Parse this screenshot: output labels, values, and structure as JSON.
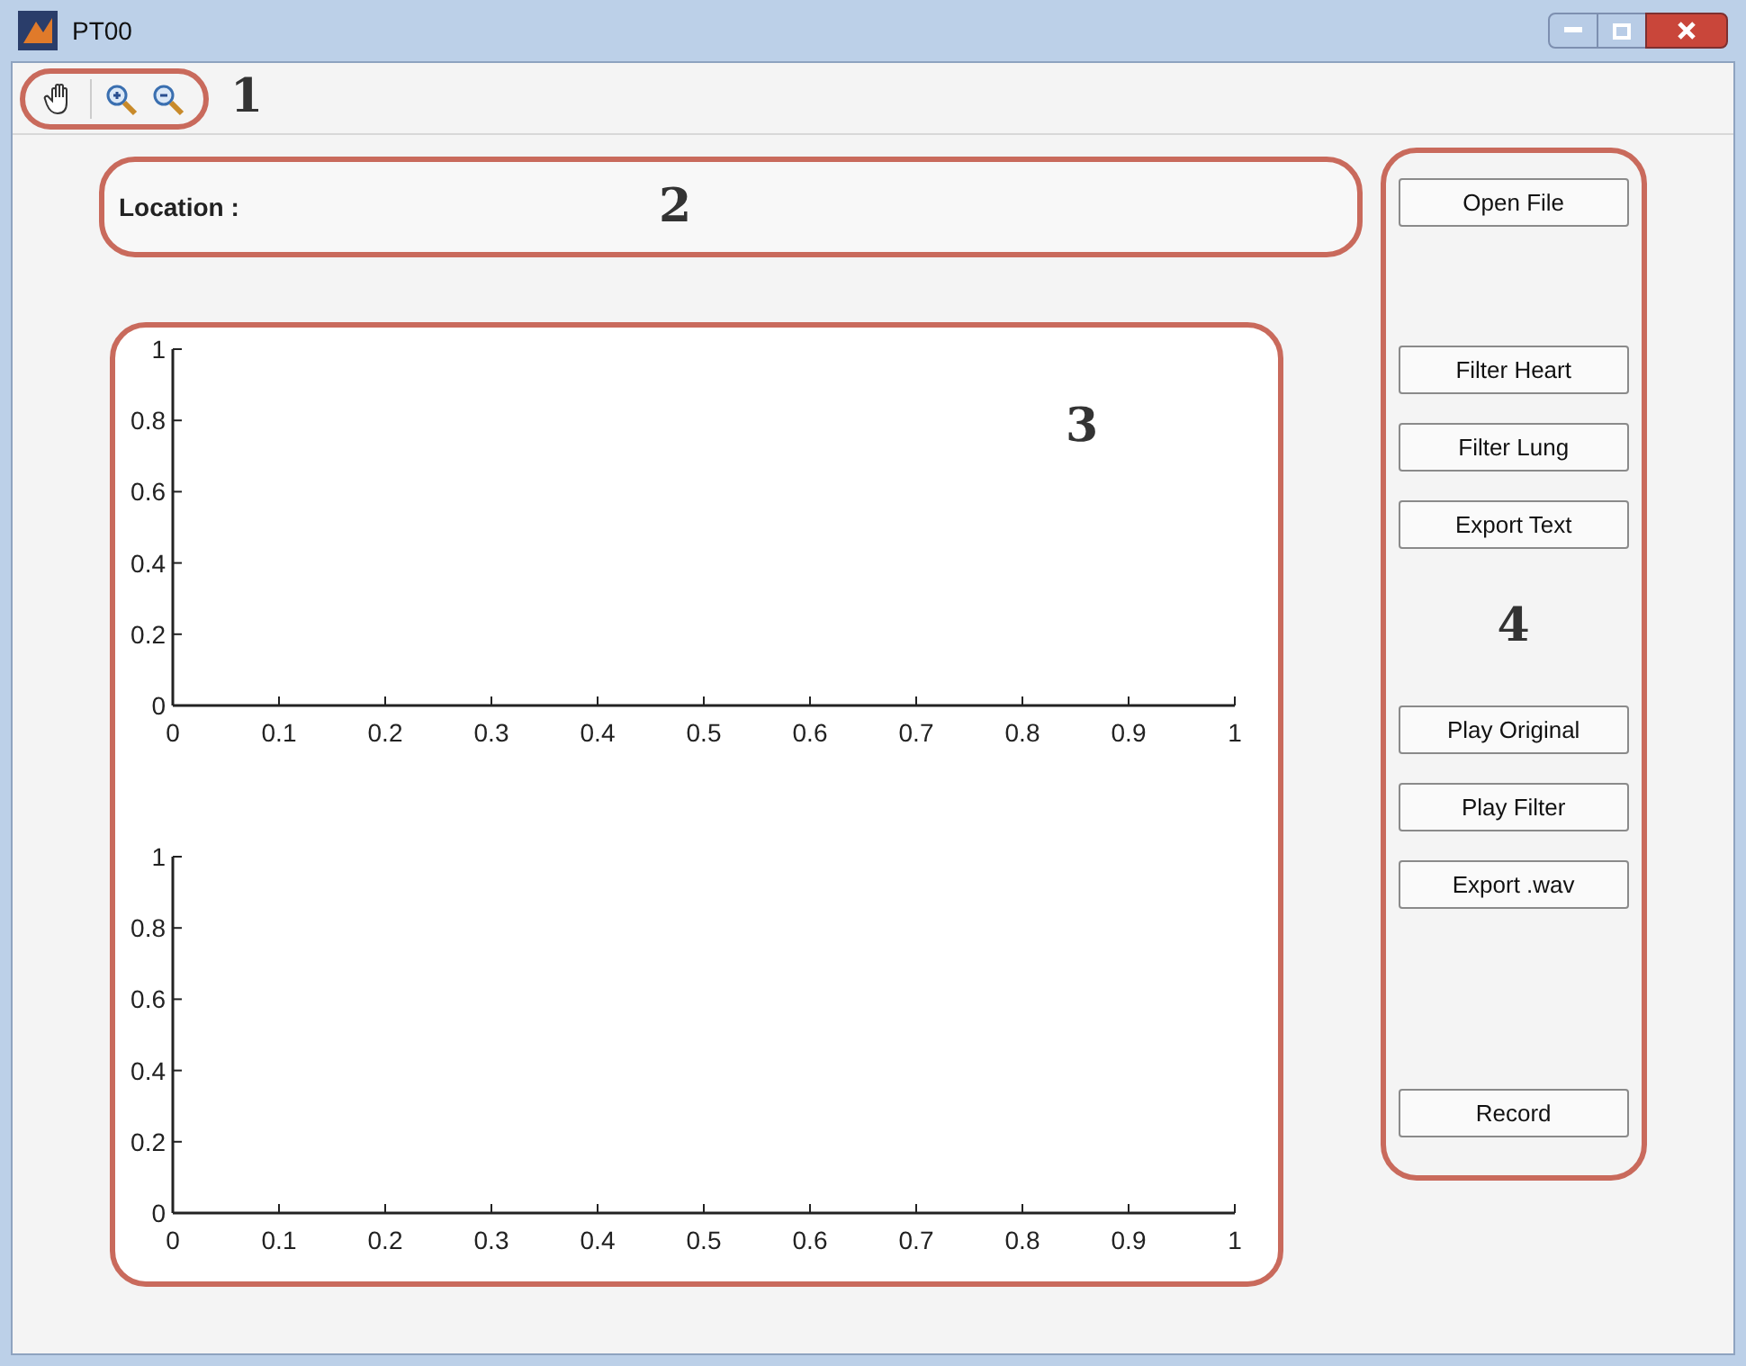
{
  "window": {
    "title": "PT00"
  },
  "toolbar": {
    "annotation": "1"
  },
  "location": {
    "label": "Location :",
    "annotation": "2"
  },
  "plots": {
    "annotation": "3",
    "axes": [
      {
        "chart_data": {
          "type": "line",
          "xlim": [
            0,
            1
          ],
          "ylim": [
            0,
            1
          ],
          "xticks": [
            0,
            0.1,
            0.2,
            0.3,
            0.4,
            0.5,
            0.6,
            0.7,
            0.8,
            0.9,
            1
          ],
          "yticks": [
            0,
            0.2,
            0.4,
            0.6,
            0.8,
            1
          ]
        }
      },
      {
        "chart_data": {
          "type": "line",
          "xlim": [
            0,
            1
          ],
          "ylim": [
            0,
            1
          ],
          "xticks": [
            0,
            0.1,
            0.2,
            0.3,
            0.4,
            0.5,
            0.6,
            0.7,
            0.8,
            0.9,
            1
          ],
          "yticks": [
            0,
            0.2,
            0.4,
            0.6,
            0.8,
            1
          ]
        }
      }
    ]
  },
  "controls": {
    "annotation": "4",
    "groups": [
      [
        "Open File"
      ],
      [
        "Filter Heart",
        "Filter Lung",
        "Export Text"
      ],
      [
        "Play Original",
        "Play Filter",
        "Export .wav"
      ],
      [
        "Record"
      ]
    ]
  }
}
